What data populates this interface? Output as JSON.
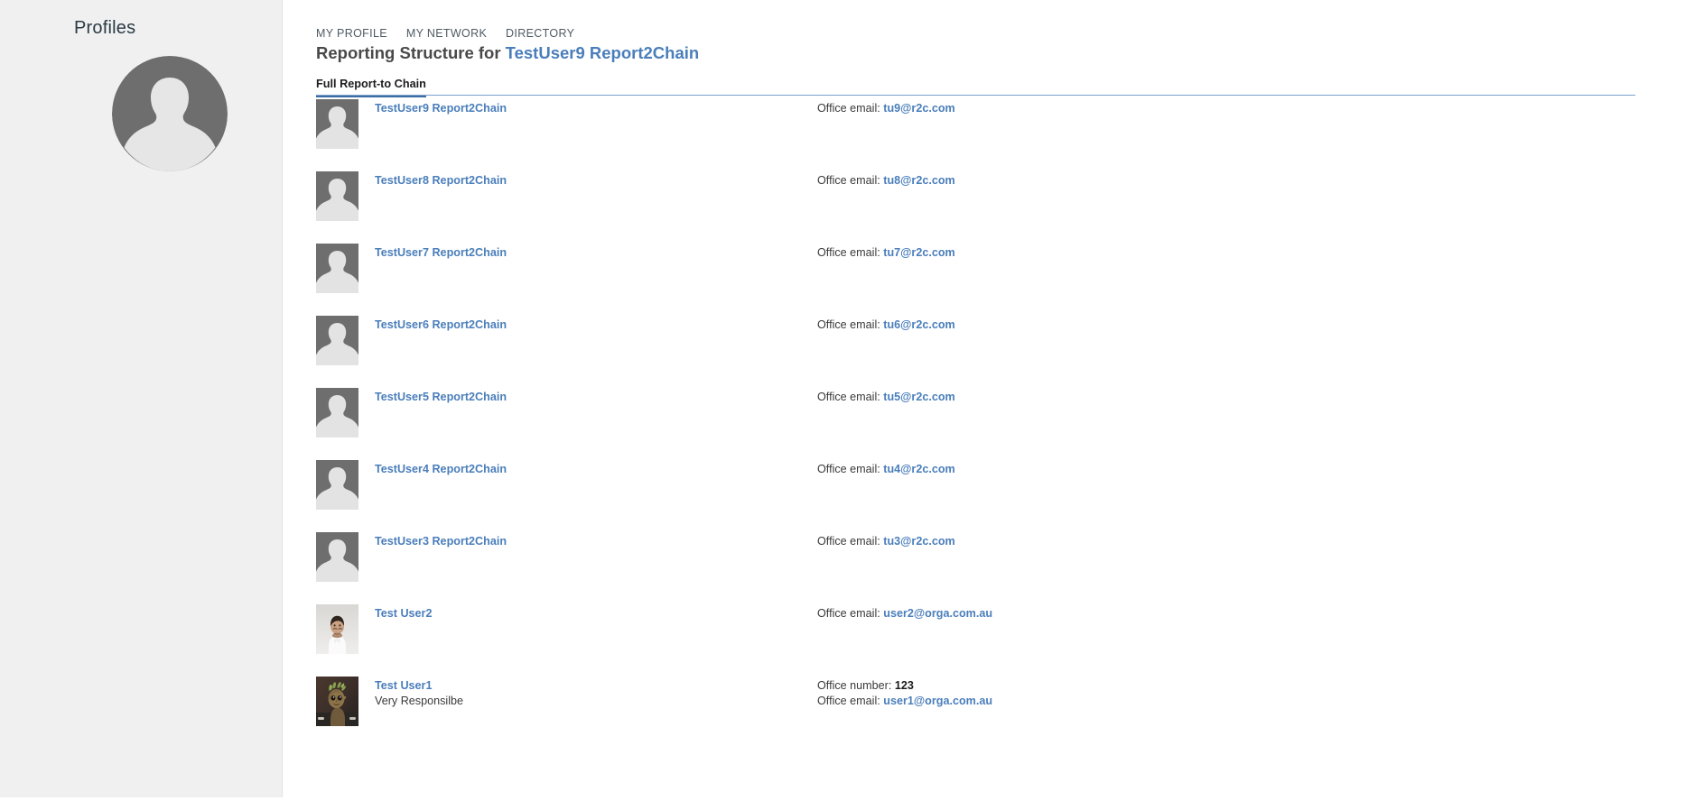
{
  "sidebar": {
    "title": "Profiles",
    "avatar_icon": "person-placeholder-icon"
  },
  "search": {
    "icon": "search-icon"
  },
  "topnav": {
    "items": [
      {
        "label": "MY PROFILE"
      },
      {
        "label": "MY NETWORK"
      },
      {
        "label": "DIRECTORY"
      }
    ]
  },
  "header": {
    "title_prefix": "Reporting Structure for ",
    "subject": "TestUser9 Report2Chain"
  },
  "tabs": {
    "active": "Full Report-to Chain"
  },
  "labels": {
    "office_email": "Office email:",
    "office_number": "Office number:"
  },
  "people": [
    {
      "name": "TestUser9 Report2Chain",
      "job_title": "",
      "office_number": "",
      "office_email": "tu9@r2c.com",
      "avatar": "placeholder"
    },
    {
      "name": "TestUser8 Report2Chain",
      "job_title": "",
      "office_number": "",
      "office_email": "tu8@r2c.com",
      "avatar": "placeholder"
    },
    {
      "name": "TestUser7 Report2Chain",
      "job_title": "",
      "office_number": "",
      "office_email": "tu7@r2c.com",
      "avatar": "placeholder"
    },
    {
      "name": "TestUser6 Report2Chain",
      "job_title": "",
      "office_number": "",
      "office_email": "tu6@r2c.com",
      "avatar": "placeholder"
    },
    {
      "name": "TestUser5 Report2Chain",
      "job_title": "",
      "office_number": "",
      "office_email": "tu5@r2c.com",
      "avatar": "placeholder"
    },
    {
      "name": "TestUser4 Report2Chain",
      "job_title": "",
      "office_number": "",
      "office_email": "tu4@r2c.com",
      "avatar": "placeholder"
    },
    {
      "name": "TestUser3 Report2Chain",
      "job_title": "",
      "office_number": "",
      "office_email": "tu3@r2c.com",
      "avatar": "placeholder"
    },
    {
      "name": "Test User2",
      "job_title": "",
      "office_number": "",
      "office_email": "user2@orga.com.au",
      "avatar": "photo-man-white-shirt"
    },
    {
      "name": "Test User1",
      "job_title": "Very Responsilbe",
      "office_number": "123",
      "office_email": "user1@orga.com.au",
      "avatar": "photo-groot"
    }
  ],
  "colors": {
    "link": "#4a7ebb",
    "accent": "#3b72b5",
    "tab_underline": "#3c6ea5",
    "sidebar_bg": "#f0f0f0"
  }
}
